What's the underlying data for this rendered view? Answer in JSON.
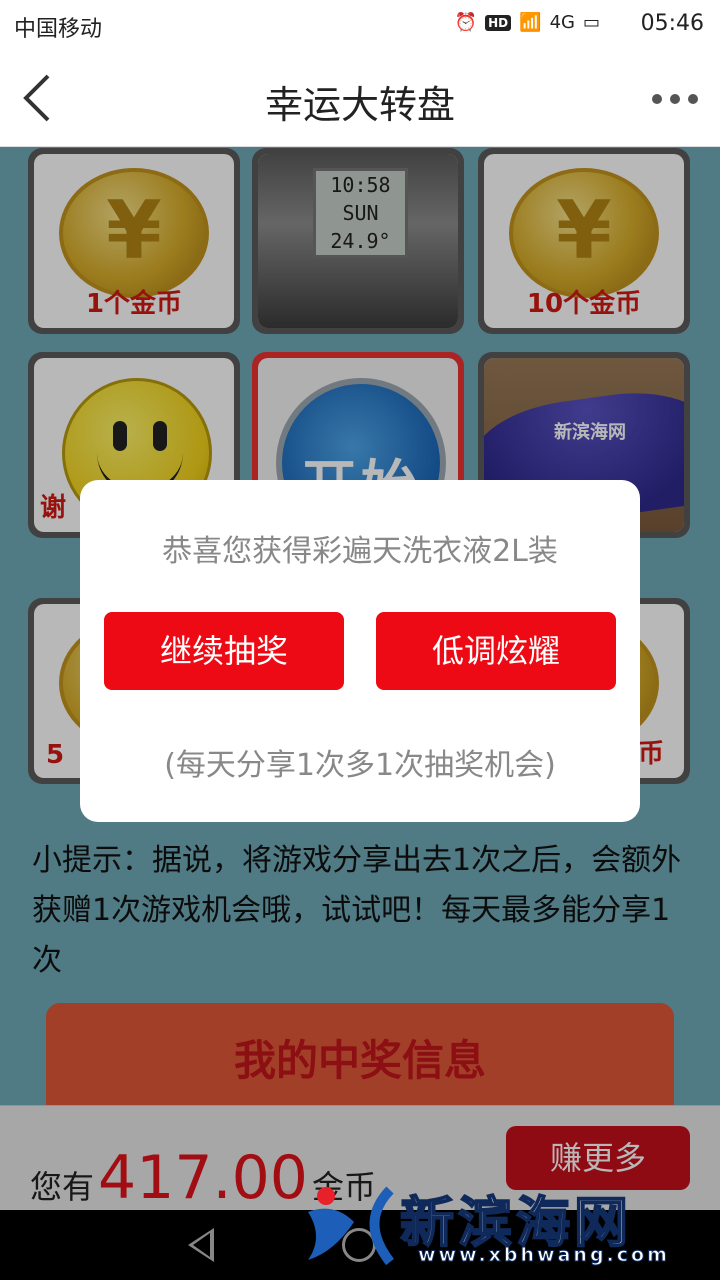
{
  "status_bar": {
    "carrier": "中国移动",
    "hd": "HD",
    "signal": "4G",
    "time": "05:46"
  },
  "nav": {
    "title": "幸运大转盘"
  },
  "grid": {
    "coin_1_label": "1个金币",
    "coin_10_label": "10个金币",
    "clock": {
      "time": "10:58",
      "day": "SUN",
      "temp": "24.9°"
    },
    "start_label": "开始",
    "umbrella_brand": "新滨海网",
    "smiley_label": "谢",
    "coin_5_label": "5",
    "coin_br_label": "币"
  },
  "hint": "小提示：据说，将游戏分享出去1次之后，会额外获赠1次游戏机会哦，试试吧！每天最多能分享1次",
  "prize_info_label": "我的中奖信息",
  "bottom": {
    "prefix": "您有",
    "amount": "417.00",
    "suffix": "金币",
    "earn_label": "赚更多"
  },
  "dialog": {
    "message": "恭喜您获得彩遍天洗衣液2L装",
    "continue_label": "继续抽奖",
    "lowkey_label": "低调炫耀",
    "note": "(每天分享1次多1次抽奖机会)"
  },
  "watermark": {
    "text": "新滨海网",
    "url": "www.xbhwang.com"
  },
  "colors": {
    "accent_red": "#ee0a14",
    "background_teal": "#6fa9b7"
  }
}
